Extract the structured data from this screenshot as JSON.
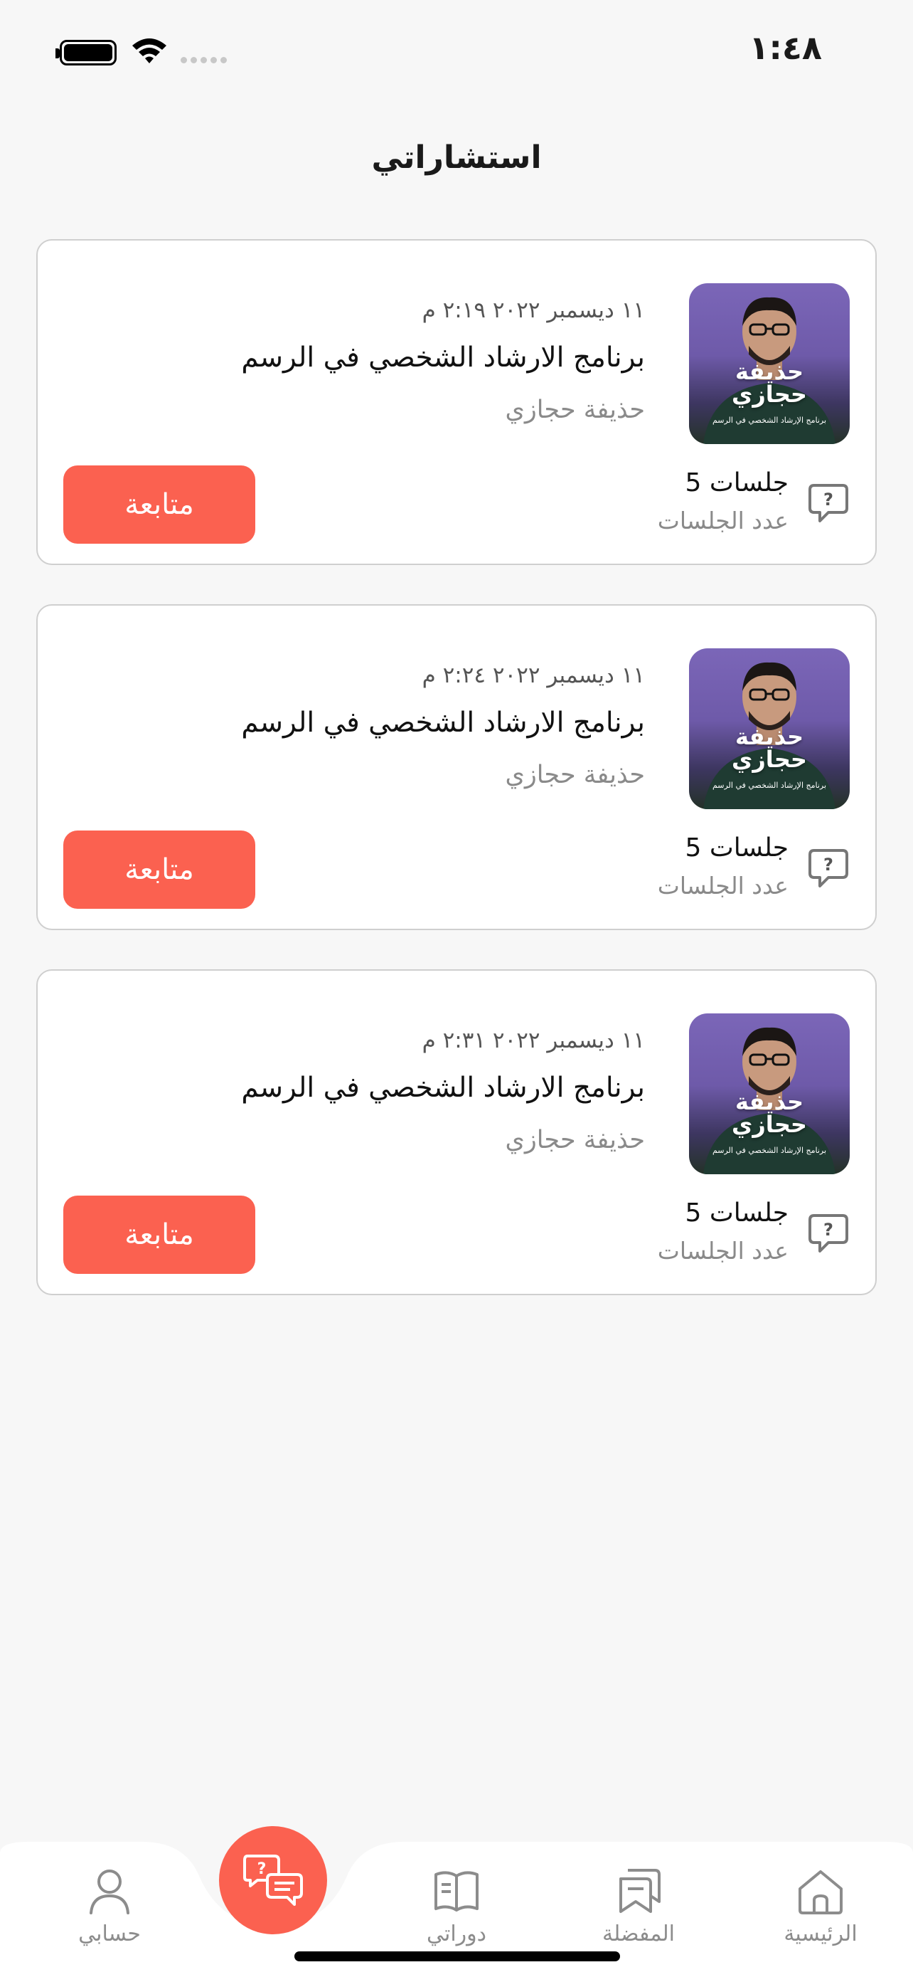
{
  "status_bar": {
    "time": "١:٤٨"
  },
  "header": {
    "title": "استشاراتي"
  },
  "consultations": [
    {
      "thumb_name_line1": "حذيفة",
      "thumb_name_line2": "حجازي",
      "thumb_sub": "برنامج الإرشاد الشخصي في الرسم",
      "date": "١١ ديسمبر ٢٠٢٢ ٢:١٩ م",
      "title": "برنامج الارشاد الشخصي في الرسم",
      "author": "حذيفة حجازي",
      "sessions_value": "5 جلسات",
      "sessions_label": "عدد الجلسات",
      "action_label": "متابعة"
    },
    {
      "thumb_name_line1": "حذيفة",
      "thumb_name_line2": "حجازي",
      "thumb_sub": "برنامج الإرشاد الشخصي في الرسم",
      "date": "١١ ديسمبر ٢٠٢٢ ٢:٢٤ م",
      "title": "برنامج الارشاد الشخصي في الرسم",
      "author": "حذيفة حجازي",
      "sessions_value": "5 جلسات",
      "sessions_label": "عدد الجلسات",
      "action_label": "متابعة"
    },
    {
      "thumb_name_line1": "حذيفة",
      "thumb_name_line2": "حجازي",
      "thumb_sub": "برنامج الإرشاد الشخصي في الرسم",
      "date": "١١ ديسمبر ٢٠٢٢ ٢:٣١ م",
      "title": "برنامج الارشاد الشخصي في الرسم",
      "author": "حذيفة حجازي",
      "sessions_value": "5 جلسات",
      "sessions_label": "عدد الجلسات",
      "action_label": "متابعة"
    }
  ],
  "tab_bar": {
    "home": "الرئيسية",
    "favorites": "المفضلة",
    "courses": "دوراتي",
    "account": "حسابي",
    "center_icon": "consultations-chat-icon"
  },
  "colors": {
    "accent": "#fb6150",
    "background": "#f7f7f7",
    "card": "#ffffff",
    "muted_text": "#8a8a8a"
  }
}
